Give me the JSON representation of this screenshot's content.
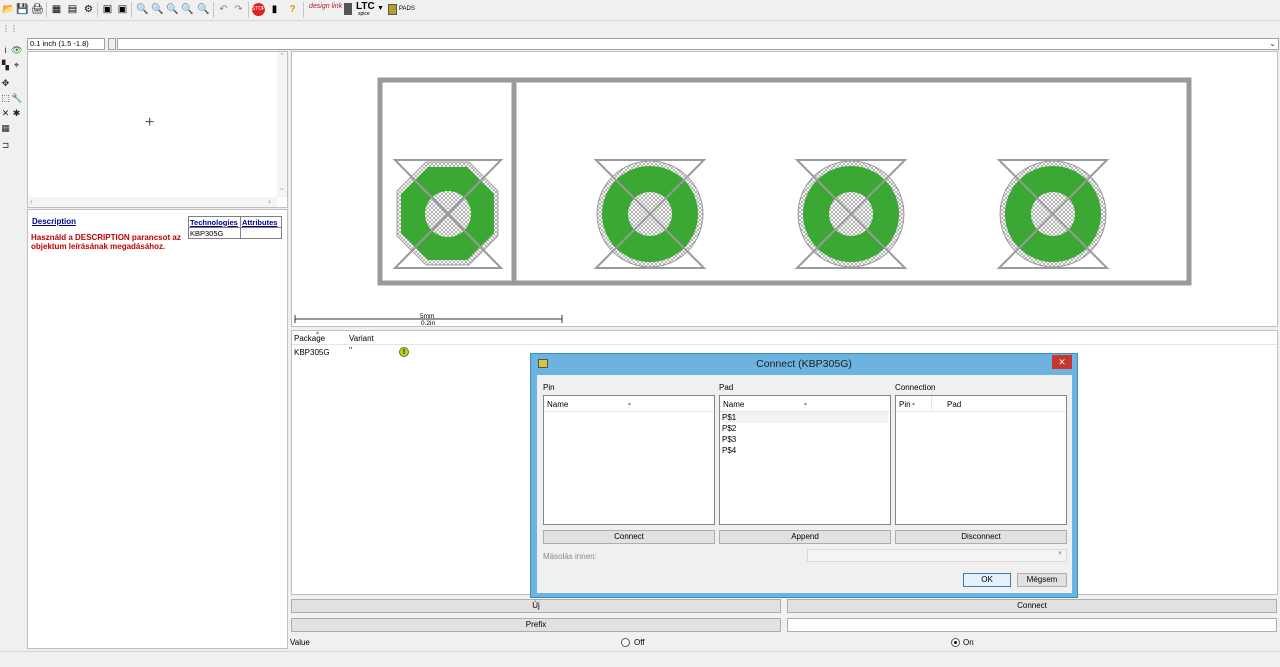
{
  "toolbar": {
    "icons": [
      "open-icon",
      "save-icon",
      "print-icon",
      "cam-icon",
      "board-icon",
      "script-icon",
      "ulp-icon",
      "run-ulp-icon",
      "cam2-icon",
      "zoom-in-icon",
      "zoom-out-icon",
      "zoom-fit-icon",
      "zoom-select-icon",
      "zoom-last-icon",
      "undo-icon",
      "redo-icon",
      "stop-icon",
      "drc-icon",
      "help-icon"
    ],
    "design_link_label": "design link",
    "ltspice_label": "LTC",
    "ltspice_sub": "spice",
    "pads_label": "PADS"
  },
  "coord_readout": "0.1 inch (1.5 -1.8)",
  "description": {
    "link": "Description",
    "text": "Használd a DESCRIPTION parancsot az objektum leírásának megadásához."
  },
  "tech_table": {
    "headers": [
      "Technologies",
      "Attributes"
    ],
    "rows": [
      [
        "KBP305G",
        ""
      ]
    ]
  },
  "scale_bar": {
    "label_mm": "5mm",
    "label_in": "0.2in"
  },
  "variant_list": {
    "headers": [
      "Package",
      "Variant"
    ],
    "rows": [
      {
        "package": "KBP305G",
        "variant": "''"
      }
    ]
  },
  "buttons": {
    "new": "Új",
    "connect": "Connect",
    "prefix": "Prefix"
  },
  "value_row": {
    "label": "Value",
    "off": "Off",
    "on": "On",
    "selected": "On"
  },
  "dialog": {
    "title": "Connect  (KBP305G)",
    "close": "✕",
    "pin_group": "Pin",
    "pad_group": "Pad",
    "connection_group": "Connection",
    "pin_list": {
      "header": "Name",
      "items": []
    },
    "pad_list": {
      "header": "Name",
      "items": [
        "P$1",
        "P$2",
        "P$3",
        "P$4"
      ]
    },
    "connection_list": {
      "headers": [
        "Pin",
        "Pad"
      ],
      "items": []
    },
    "connect_btn": "Connect",
    "append_btn": "Append",
    "disconnect_btn": "Disconnect",
    "copy_from_label": "Másolás innen:",
    "ok_btn": "OK",
    "cancel_btn": "Mégsem"
  },
  "colors": {
    "pad_green": "#3aa832",
    "outline_gray": "#9a9a9a",
    "dialog_frame": "#6cb3e0",
    "description_red": "#c00000",
    "link_blue": "#00008b"
  }
}
